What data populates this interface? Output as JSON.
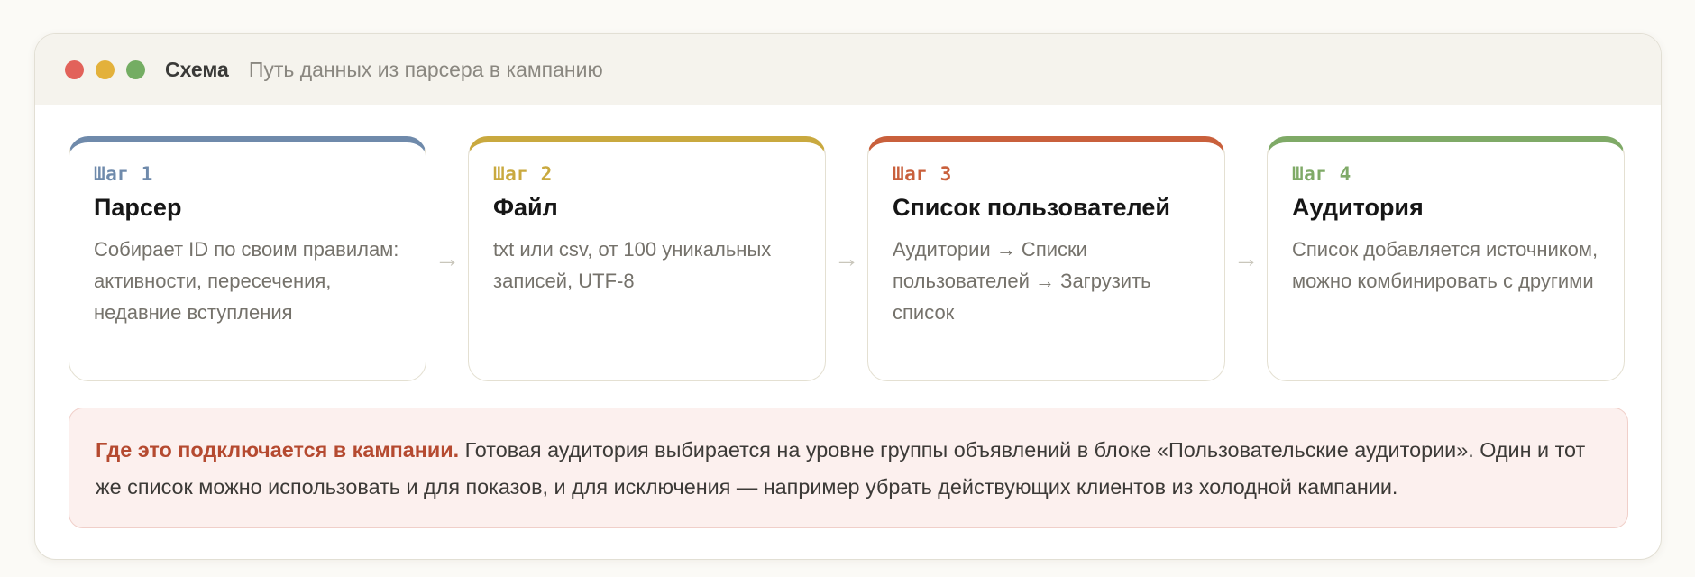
{
  "window": {
    "title": "Схема",
    "subtitle": "Путь данных из парсера в кампанию",
    "controls": [
      "close",
      "minimize",
      "maximize"
    ]
  },
  "steps": [
    {
      "label": "Шаг 1",
      "title": "Парсер",
      "description": "Собирает ID по своим правилам: активности, пересечения, недавние вступления",
      "accent": "#6f8aab"
    },
    {
      "label": "Шаг 2",
      "title": "Файл",
      "description": "txt или csv, от 100 уникальных записей, UTF-8",
      "accent": "#c9a93f"
    },
    {
      "label": "Шаг 3",
      "title": "Список пользователей",
      "description": "Аудитории → Списки пользователей → Загрузить список",
      "accent": "#c9603c"
    },
    {
      "label": "Шаг 4",
      "title": "Аудитория",
      "description": "Список добавляется источником, можно комбинировать с другими",
      "accent": "#7faa67"
    }
  ],
  "arrow_glyph": "→",
  "note": {
    "lead": "Где это подключается в кампании.",
    "body": "Готовая аудитория выбирается на уровне группы объявлений в блоке «Пользовательские аудитории». Один и тот же список можно использовать и для показов, и для исключения — например убрать действующих клиентов из холодной кампании."
  }
}
